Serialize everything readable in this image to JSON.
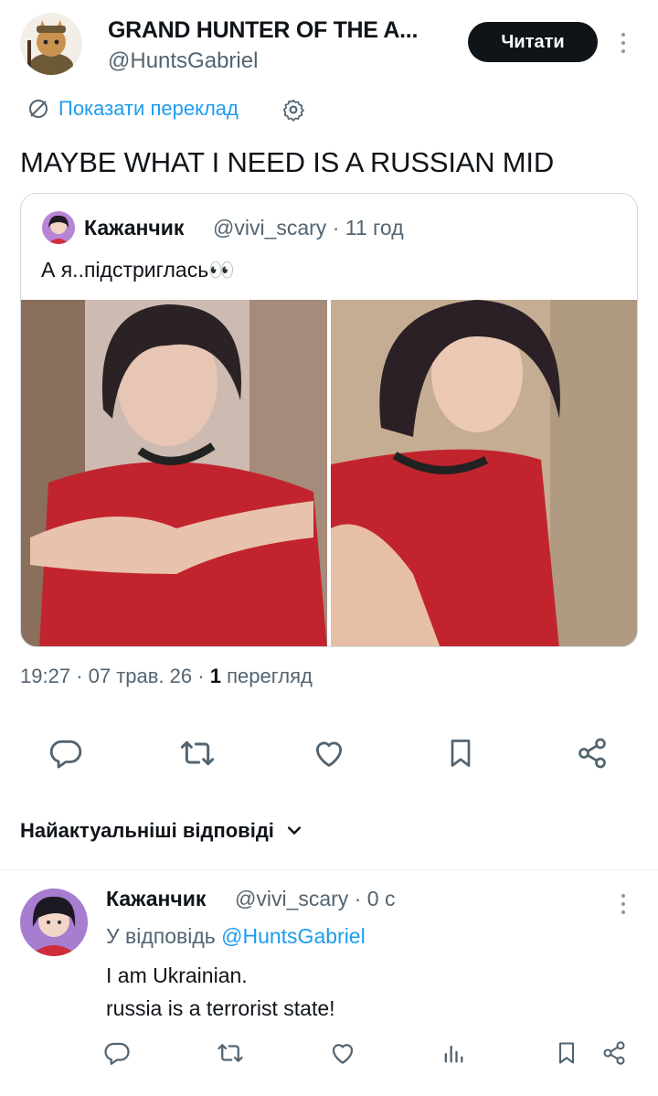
{
  "post": {
    "display_name": "GRAND HUNTER OF THE A...",
    "handle": "@HuntsGabriel",
    "read_button": "Читати",
    "translate_label": "Показати переклад",
    "text": "MAYBE WHAT I NEED IS A RUSSIAN MID",
    "time": "19:27",
    "date": "07 трав. 26",
    "views_count": "1",
    "views_label": "перегляд"
  },
  "quote": {
    "name": "Кажанчик",
    "handle": "@vivi_scary",
    "age": "11 год",
    "text": "А я..підстриглась👀"
  },
  "sort_label": "Найактуальніші відповіді",
  "reply": {
    "name": "Кажанчик",
    "handle": "@vivi_scary",
    "age": "0 с",
    "replying_prefix": "У відповідь",
    "replying_to": "@HuntsGabriel",
    "line1": "I am Ukrainian.",
    "line2": "russia is a terrorist state!"
  },
  "colors": {
    "accent": "#1d9bf0",
    "text": "#0f1419",
    "muted": "#536471",
    "border": "#cfd9de"
  },
  "icons": [
    "translate-icon",
    "gear-icon",
    "reply-icon",
    "retweet-icon",
    "like-icon",
    "bookmark-icon",
    "share-icon",
    "views-icon",
    "chevron-down-icon",
    "more-vertical-icon"
  ]
}
